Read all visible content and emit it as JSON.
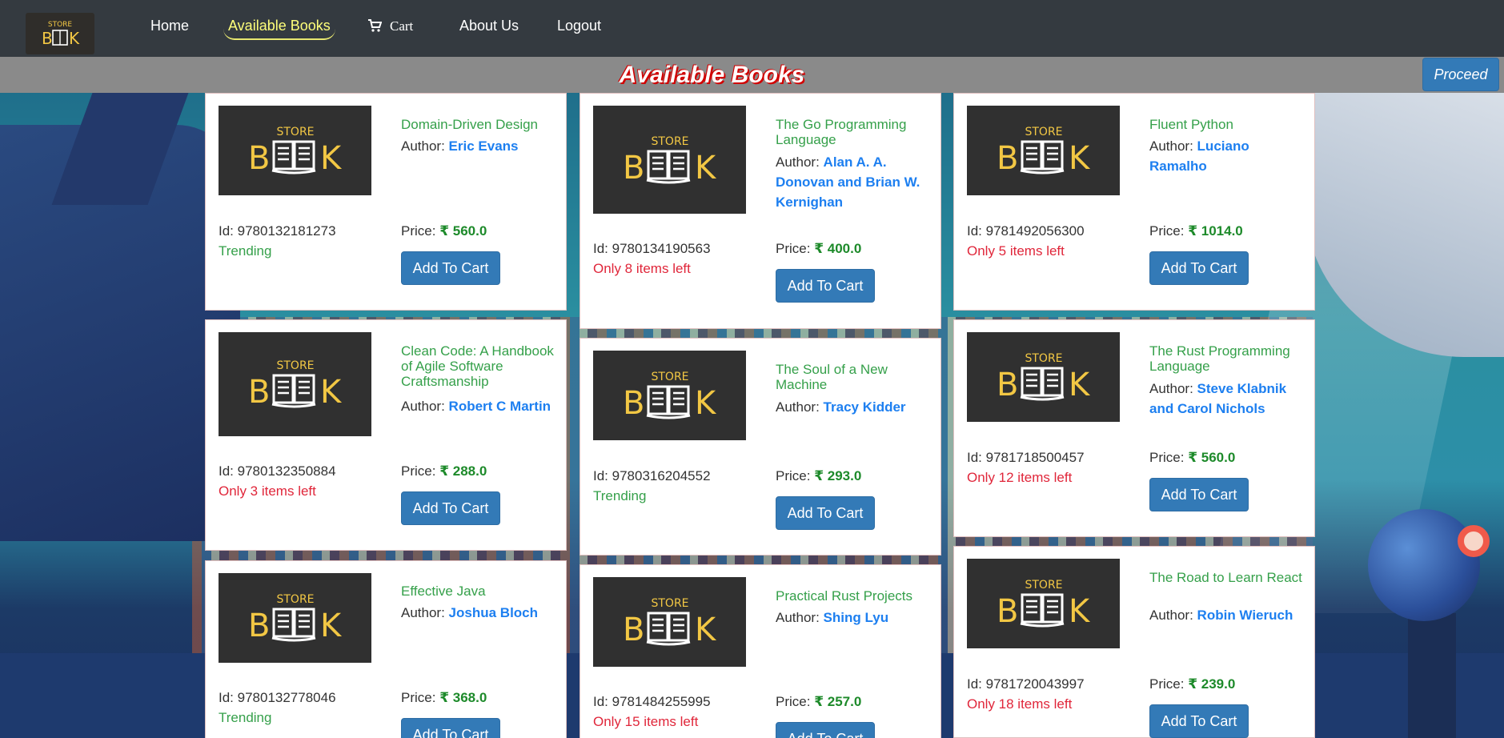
{
  "nav": {
    "brand_top": "STORE",
    "brand_mark": "B◫K",
    "items": [
      {
        "label": "Home"
      },
      {
        "label": "Available Books"
      },
      {
        "label": "Cart"
      },
      {
        "label": "About Us"
      },
      {
        "label": "Logout"
      }
    ]
  },
  "header": {
    "title": "Available Books",
    "proceed_label": "Proceed"
  },
  "labels": {
    "id": "Id: ",
    "author": "Author: ",
    "price": "Price: ",
    "currency": "₹ ",
    "add_to_cart": "Add To Cart"
  },
  "thumb_text": {
    "top": "STORE",
    "left": "B",
    "right": "K"
  },
  "books": [
    {
      "title": "Domain-Driven Design",
      "author": "Eric Evans",
      "id": "9780132181273",
      "price": "560.0",
      "status": "Trending",
      "status_type": "trend"
    },
    {
      "title": "The Go Programming Language",
      "author": "Alan A. A. Donovan and Brian W. Kernighan",
      "id": "9780134190563",
      "price": "400.0",
      "status": "Only 8 items left",
      "status_type": "low"
    },
    {
      "title": "Fluent Python",
      "author": "Luciano Ramalho",
      "id": "9781492056300",
      "price": "1014.0",
      "status": "Only 5 items left",
      "status_type": "low"
    },
    {
      "title": "Clean Code: A Handbook of Agile Software Craftsmanship",
      "author": "Robert C Martin",
      "id": "9780132350884",
      "price": "288.0",
      "status": "Only 3 items left",
      "status_type": "low"
    },
    {
      "title": "The Soul of a New Machine",
      "author": "Tracy Kidder",
      "id": "9780316204552",
      "price": "293.0",
      "status": "Trending",
      "status_type": "trend"
    },
    {
      "title": "The Rust Programming Language",
      "author": "Steve Klabnik and Carol Nichols",
      "id": "9781718500457",
      "price": "560.0",
      "status": "Only 12 items left",
      "status_type": "low"
    },
    {
      "title": "Effective Java",
      "author": "Joshua Bloch",
      "id": "9780132778046",
      "price": "368.0",
      "status": "Trending",
      "status_type": "trend"
    },
    {
      "title": "Practical Rust Projects",
      "author": "Shing Lyu",
      "id": "9781484255995",
      "price": "257.0",
      "status": "Only 15 items left",
      "status_type": "low"
    },
    {
      "title": "The Road to Learn React",
      "author": "Robin Wieruch",
      "id": "9781720043997",
      "price": "239.0",
      "status": "Only 18 items left",
      "status_type": "low"
    }
  ]
}
